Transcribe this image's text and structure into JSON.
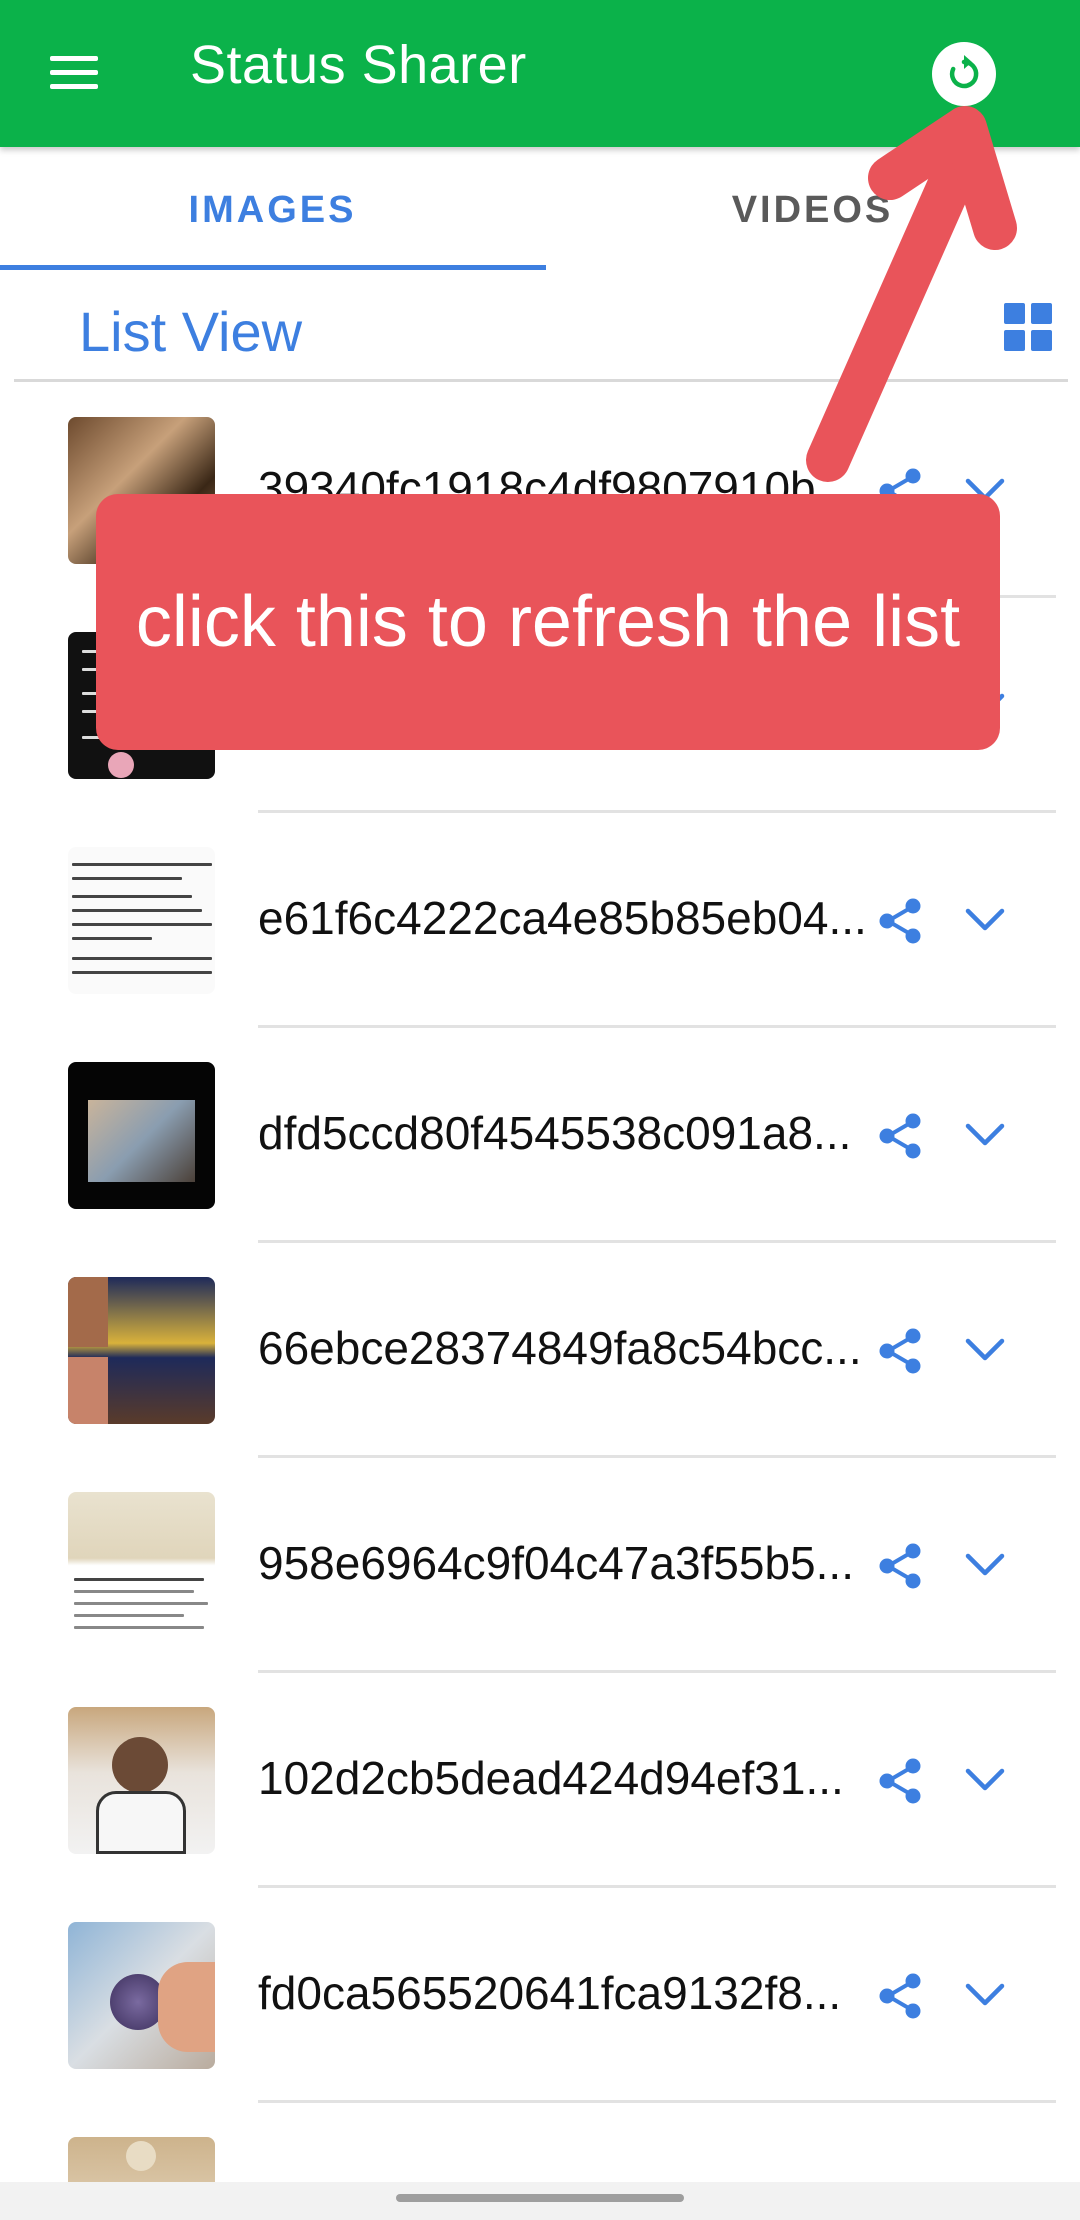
{
  "app": {
    "title": "Status Sharer"
  },
  "tabs": [
    {
      "label": "IMAGES",
      "selected": true
    },
    {
      "label": "VIDEOS",
      "selected": false
    }
  ],
  "list_header": {
    "title": "List View",
    "view_toggle_icon": "grid-view-icon"
  },
  "files": [
    {
      "name": "39340fc1918c4df9807910b"
    },
    {
      "name": ""
    },
    {
      "name": "e61f6c4222ca4e85b85eb04..."
    },
    {
      "name": "dfd5ccd80f4545538c091a8..."
    },
    {
      "name": "66ebce28374849fa8c54bcc..."
    },
    {
      "name": "958e6964c9f04c47a3f55b5..."
    },
    {
      "name": "102d2cb5dead424d94ef31..."
    },
    {
      "name": "fd0ca565520641fca9132f8..."
    },
    {
      "name": ""
    }
  ],
  "row_icons": {
    "share": "share-icon",
    "expand": "chevron-down-icon"
  },
  "tutorial": {
    "callout_text": "click this to refresh the list"
  },
  "colors": {
    "app_bar": "#0bb24a",
    "accent": "#3d7fe0",
    "callout": "#e9545a"
  }
}
